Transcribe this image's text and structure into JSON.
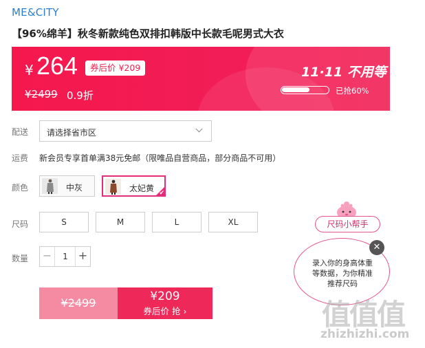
{
  "brand": "ME&CITY",
  "product_title": "【96%绵羊】秋冬新款纯色双排扣韩版中长款毛呢男式大衣",
  "price_banner": {
    "currency": "¥",
    "price": "264",
    "coupon_tag": "券后价 ¥209",
    "original_price": "¥2499",
    "discount": "0.9折",
    "event_title": "11·11 不用等",
    "progress_percent": 60,
    "progress_label": "已抢60%",
    "colors": {
      "banner": "#f31c52",
      "text": "#ffffff"
    }
  },
  "delivery": {
    "label": "配送",
    "region_placeholder": "请选择省市区"
  },
  "shipping": {
    "label": "运费",
    "text": "新会员专享首单满38元免邮（限唯品自营商品，部分商品不可用）"
  },
  "color": {
    "label": "颜色",
    "options": [
      {
        "name": "中灰",
        "selected": false
      },
      {
        "name": "太妃黄",
        "selected": true
      }
    ]
  },
  "size": {
    "label": "尺码",
    "options": [
      "S",
      "M",
      "L",
      "XL"
    ]
  },
  "quantity": {
    "label": "数量",
    "value": "1",
    "minus": "−",
    "plus": "+"
  },
  "buy": {
    "original_price": "¥2499",
    "coupon_price": "¥209",
    "coupon_action": "券后价 抢 ›"
  },
  "size_helper": {
    "button": "尺码小帮手",
    "tip": "录入你的身高体重等数据，为你精准推荐尺码",
    "close": "✕"
  },
  "watermark": {
    "glyphs": "值值值",
    "url": "zhizhizhi.com"
  },
  "accent_color": "#ee2858",
  "link_color": "#2a7fd4"
}
